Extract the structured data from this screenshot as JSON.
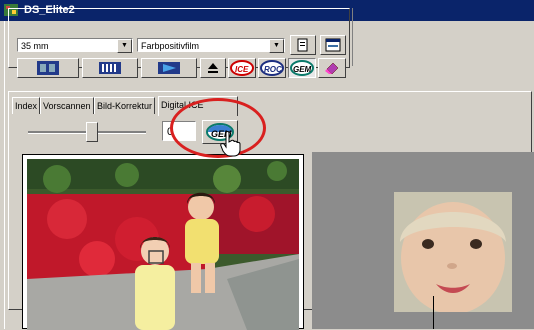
{
  "window": {
    "title": "DS_Elite2"
  },
  "controls": {
    "film_size": "35 mm",
    "film_type": "Farbpositivfilm"
  },
  "tabs": [
    {
      "label": "Index"
    },
    {
      "label": "Vorscannen"
    },
    {
      "label": "Bild-Korrektur"
    },
    {
      "label": "Digital ICE"
    }
  ],
  "gem": {
    "level_value": "0",
    "button_label": "GEM"
  },
  "toolbar_icons": [
    "thumbnails-icon",
    "film-strip-icon",
    "prescan-icon",
    "eject-icon",
    "ice-icon",
    "roc-icon",
    "gem-icon",
    "eraser-icon"
  ],
  "colors": {
    "highlight": "#d9201f",
    "titlebar": "#0a246a"
  }
}
